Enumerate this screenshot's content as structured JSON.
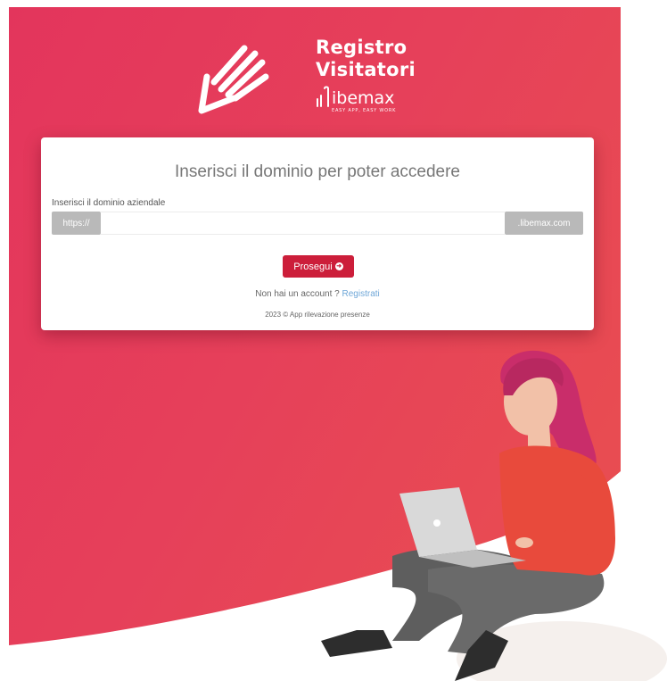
{
  "brand": {
    "title_line1": "Registro",
    "title_line2": "Visitatori",
    "logo_word": "ibemax",
    "tagline": "EASY APP, EASY WORK",
    "icon": "hand-pen-icon"
  },
  "card": {
    "title": "Inserisci il dominio per poter accedere",
    "domain_label": "Inserisci il dominio aziendale",
    "prefix": "https://",
    "suffix": ".libemax.com",
    "input_value": "",
    "input_placeholder": "",
    "submit_label": "Prosegui",
    "submit_icon": "arrow-circle-right-icon",
    "no_account_text": "Non hai un account ?",
    "register_link": "Registrati",
    "copyright": "2023 © App rilevazione presenze"
  },
  "colors": {
    "background_gradient": [
      "#e3355c",
      "#e9504f"
    ],
    "submit_button": "#cc1e3a",
    "link": "#6fa7d8",
    "addon": "#b9b9b9"
  },
  "illustration": "woman-with-laptop"
}
